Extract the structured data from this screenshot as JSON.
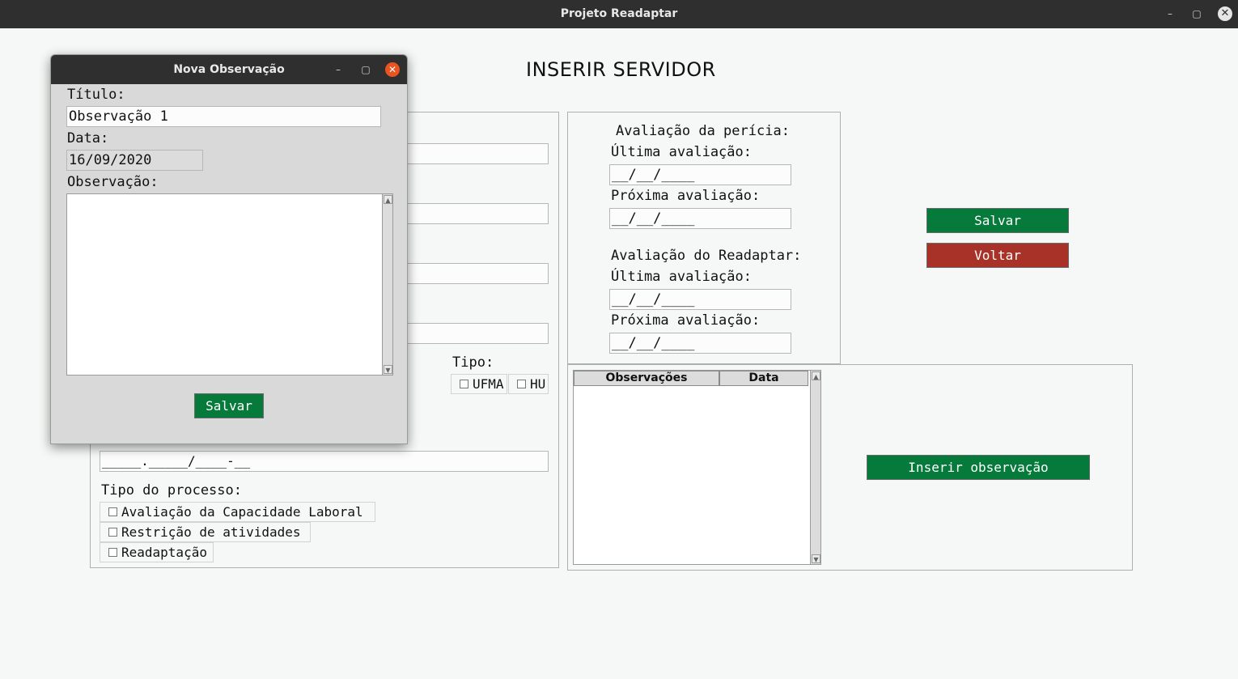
{
  "window": {
    "title": "Projeto Readaptar",
    "minimize": "–",
    "maximize": "▢",
    "close": "✕"
  },
  "main": {
    "heading": "INSERIR SERVIDOR",
    "tipo_label": "Tipo:",
    "tipo_options": [
      "UFMA",
      "HU"
    ],
    "process_mask": "_____._____/____-__",
    "tipo_processo_label": "Tipo do processo:",
    "tipo_processo_options": [
      "Avaliação da Capacidade Laboral",
      "Restrição de atividades",
      "Readaptação"
    ]
  },
  "evaluations": {
    "pericia_title": "Avaliação da perícia:",
    "readaptar_title": "Avaliação do Readaptar:",
    "ultima_label": "Última avaliação:",
    "proxima_label": "Próxima avaliação:",
    "date_mask": "__/__/____"
  },
  "actions": {
    "save": "Salvar",
    "back": "Voltar",
    "insert_observation": "Inserir observação"
  },
  "observations_table": {
    "columns": [
      "Observações",
      "Data"
    ],
    "rows": []
  },
  "dialog": {
    "title": "Nova Observação",
    "minimize": "–",
    "maximize": "▢",
    "close": "✕",
    "titulo_label": "Título:",
    "titulo_value": "Observação 1",
    "data_label": "Data:",
    "data_value": "16/09/2020",
    "observacao_label": "Observação:",
    "observacao_value": "",
    "save": "Salvar"
  }
}
